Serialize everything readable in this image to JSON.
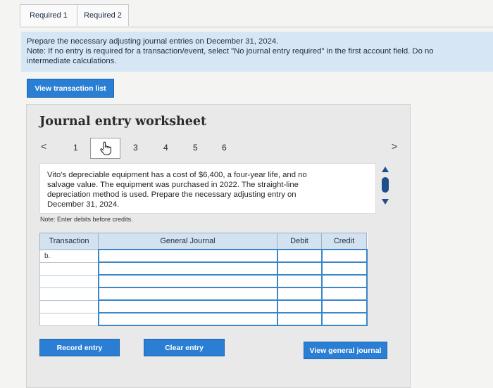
{
  "tabs": [
    "Required 1",
    "Required 2"
  ],
  "instructions": {
    "line1": "Prepare the necessary adjusting journal entries on December 31, 2024.",
    "line2": "Note: If no entry is required for a transaction/event, select \"No journal entry required\" in the first account field. Do no",
    "line3": "intermediate calculations."
  },
  "buttons": {
    "view_transaction_list": "View transaction list",
    "record_entry": "Record entry",
    "clear_entry": "Clear entry",
    "view_general_journal": "View general journal"
  },
  "worksheet": {
    "title": "Journal entry worksheet",
    "pager": {
      "prev": "<",
      "next": ">",
      "pages": [
        "1",
        "2",
        "3",
        "4",
        "5",
        "6"
      ],
      "current": "2"
    },
    "description": {
      "line1": "Vito's depreciable equipment has a cost of $6,400, a four-year life, and no",
      "line2": "salvage value. The equipment was purchased in 2022. The straight-line",
      "line3": "depreciation method is used. Prepare the necessary adjusting entry on",
      "line4": "December 31, 2024."
    },
    "note": "Note: Enter debits before credits."
  },
  "table": {
    "headers": [
      "Transaction",
      "General Journal",
      "Debit",
      "Credit"
    ],
    "rows": [
      {
        "transaction": "b.",
        "account": "",
        "debit": "",
        "credit": ""
      },
      {
        "transaction": "",
        "account": "",
        "debit": "",
        "credit": ""
      },
      {
        "transaction": "",
        "account": "",
        "debit": "",
        "credit": ""
      },
      {
        "transaction": "",
        "account": "",
        "debit": "",
        "credit": ""
      },
      {
        "transaction": "",
        "account": "",
        "debit": "",
        "credit": ""
      },
      {
        "transaction": "",
        "account": "",
        "debit": "",
        "credit": ""
      }
    ]
  },
  "colors": {
    "accent": "#2a7fd4",
    "banner": "#d6e6f4",
    "header": "#d3e2f0"
  }
}
